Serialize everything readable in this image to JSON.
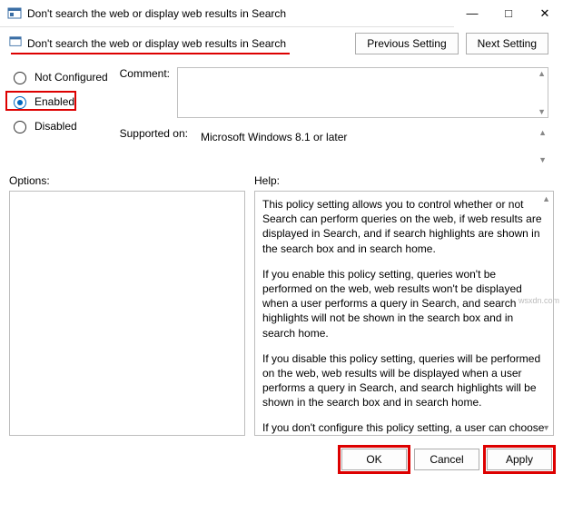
{
  "titlebar": {
    "title": "Don't search the web or display web results in Search"
  },
  "subheader": {
    "title": "Don't search the web or display web results in Search",
    "prev": "Previous Setting",
    "next": "Next Setting"
  },
  "radios": {
    "not_configured": "Not Configured",
    "enabled": "Enabled",
    "disabled": "Disabled",
    "selected": "enabled"
  },
  "labels": {
    "comment": "Comment:",
    "supported_on": "Supported on:",
    "options": "Options:",
    "help": "Help:"
  },
  "supported_text": "Microsoft Windows 8.1 or later",
  "help": {
    "p1": "This policy setting allows you to control whether or not Search can perform queries on the web, if web results are displayed in Search, and if search highlights are shown in the search box and in search home.",
    "p2": "If you enable this policy setting, queries won't be performed on the web, web results won't be displayed when a user performs a query in Search, and search highlights will not be shown in the search box and in search home.",
    "p3": "If you disable this policy setting, queries will be performed on the web, web results will be displayed when a user performs a query in Search, and search highlights will be shown in the search box and in search home.",
    "p4": "If you don't configure this policy setting, a user can choose whether or not Search can perform queries on the web, and if the web results are displayed in Search, and if search highlights are shown in the search box and in search home."
  },
  "footer": {
    "ok": "OK",
    "cancel": "Cancel",
    "apply": "Apply"
  },
  "watermark": "wsxdn.com"
}
